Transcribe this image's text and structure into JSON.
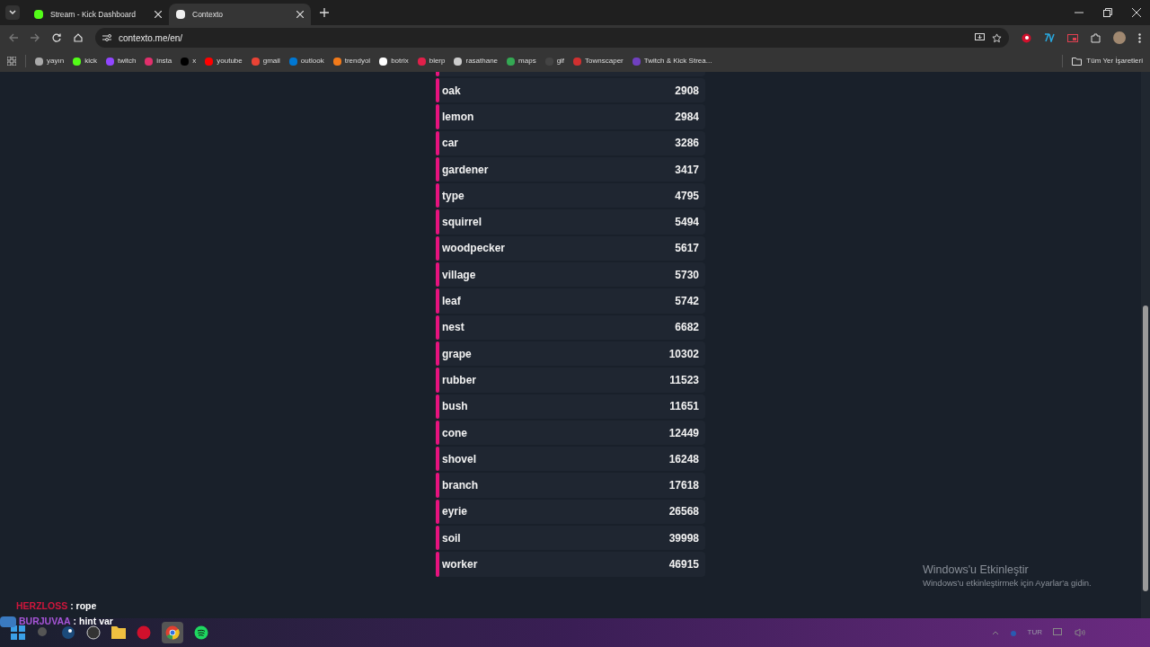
{
  "browser": {
    "tabs": [
      {
        "title": "Stream - Kick Dashboard",
        "selected": false
      },
      {
        "title": "Contexto",
        "selected": true
      }
    ],
    "address": "contexto.me/en/",
    "bookmarks": [
      "yayın",
      "kick",
      "twitch",
      "insta",
      "x",
      "youtube",
      "gmail",
      "outlook",
      "trendyol",
      "botrix",
      "blerp",
      "rasathane",
      "maps",
      "gif",
      "Townscaper",
      "Twitch & Kick Strea..."
    ],
    "all_bookmarks": "Tüm Yer İşaretleri"
  },
  "guesses": [
    {
      "word": "oak",
      "rank": "2908"
    },
    {
      "word": "lemon",
      "rank": "2984"
    },
    {
      "word": "car",
      "rank": "3286"
    },
    {
      "word": "gardener",
      "rank": "3417"
    },
    {
      "word": "type",
      "rank": "4795"
    },
    {
      "word": "squirrel",
      "rank": "5494"
    },
    {
      "word": "woodpecker",
      "rank": "5617"
    },
    {
      "word": "village",
      "rank": "5730"
    },
    {
      "word": "leaf",
      "rank": "5742"
    },
    {
      "word": "nest",
      "rank": "6682"
    },
    {
      "word": "grape",
      "rank": "10302"
    },
    {
      "word": "rubber",
      "rank": "11523"
    },
    {
      "word": "bush",
      "rank": "11651"
    },
    {
      "word": "cone",
      "rank": "12449"
    },
    {
      "word": "shovel",
      "rank": "16248"
    },
    {
      "word": "branch",
      "rank": "17618"
    },
    {
      "word": "eyrie",
      "rank": "26568"
    },
    {
      "word": "soil",
      "rank": "39998"
    },
    {
      "word": "worker",
      "rank": "46915"
    }
  ],
  "chat": [
    {
      "user": "HERZLOSS",
      "color": "#d0163c",
      "text": ": rope"
    },
    {
      "user": "BURJUVAA",
      "color": "#a855d8",
      "text": ": hint var"
    }
  ],
  "activation": {
    "title": "Windows'u Etkinleştir",
    "text": "Windows'u etkinleştirmek için Ayarlar'a gidin."
  },
  "taskbar": {
    "language": "TUR"
  }
}
